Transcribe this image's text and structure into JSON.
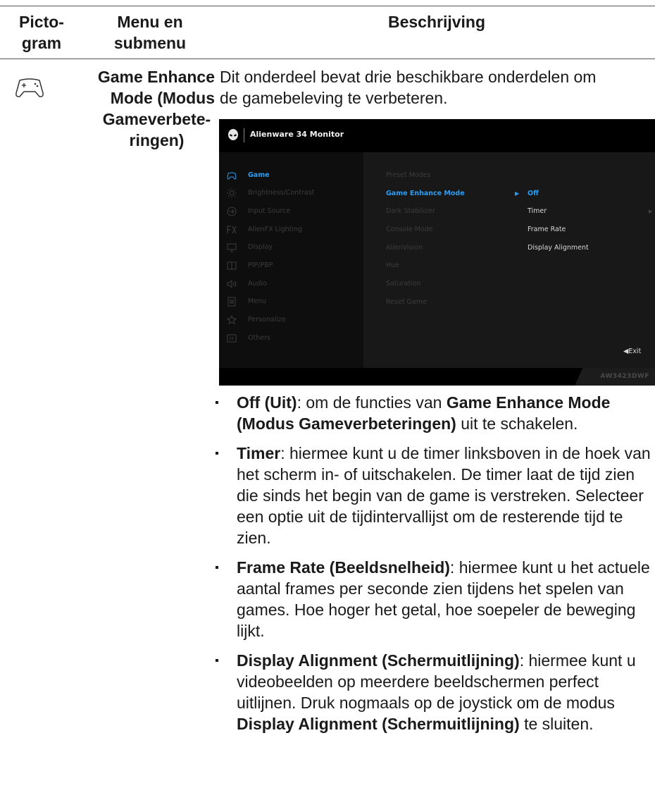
{
  "header": {
    "col1": "Picto-\ngram",
    "col2": "Menu en\nsubmenu",
    "col3": "Beschrijving"
  },
  "row": {
    "icon": "gamepad-icon",
    "menu_line1": "Game Enhance",
    "menu_line2": "Mode (Modus",
    "menu_line3": "Gameverbete-",
    "menu_line4": "ringen)",
    "intro_line1": "Dit onderdeel bevat drie beschikbare onderdelen om",
    "intro_line2": "de gamebeleving te verbeteren."
  },
  "osd": {
    "title": "Alienware 34 Monitor",
    "accent": "#2a9df4",
    "menu": [
      {
        "label": "Game",
        "icon": "gamepad-icon"
      },
      {
        "label": "Brightness/Contrast",
        "icon": "brightness-icon"
      },
      {
        "label": "Input Source",
        "icon": "input-source-icon"
      },
      {
        "label": "AlienFX Lighting",
        "icon": "fx-icon"
      },
      {
        "label": "Display",
        "icon": "display-icon"
      },
      {
        "label": "PIP/PBP",
        "icon": "pip-icon"
      },
      {
        "label": "Audio",
        "icon": "audio-icon"
      },
      {
        "label": "Menu",
        "icon": "menu-icon"
      },
      {
        "label": "Personalize",
        "icon": "star-icon"
      },
      {
        "label": "Others",
        "icon": "others-icon"
      }
    ],
    "submenu": [
      "Preset Modes",
      "Game Enhance Mode",
      "Dark Stabilizer",
      "Console Mode",
      "AlienVision",
      "Hue",
      "Saturation",
      "Reset Game"
    ],
    "options": [
      "Off",
      "Timer",
      "Frame Rate",
      "Display Alignment"
    ],
    "exit": "Exit",
    "model": "AW3423DWF"
  },
  "bullets": [
    {
      "bold": "Off (Uit)",
      "text": ": om de functies van ",
      "bold2": "Game Enhance Mode (Modus Gameverbeteringen)",
      "text2": " uit te schakelen."
    },
    {
      "bold": "Timer",
      "text": ": hiermee kunt u de timer linksboven in de hoek van het scherm in- of uitschakelen. De timer laat de tijd zien die sinds het begin van de game is verstreken. Selecteer een optie uit de tijdintervallijst om de resterende tijd te zien.",
      "bold2": "",
      "text2": ""
    },
    {
      "bold": "Frame Rate (Beeldsnelheid)",
      "text": ": hiermee kunt u het actuele aantal frames per seconde zien tijdens het spelen van games. Hoe hoger het getal, hoe soepeler de beweging lijkt.",
      "bold2": "",
      "text2": ""
    },
    {
      "bold": "Display Alignment (Schermuitlijning)",
      "text": ": hiermee kunt u videobeelden op meerdere beeldschermen perfect uitlijnen. Druk nogmaals op de joystick om de modus ",
      "bold2": "Display Alignment (Schermuitlijning)",
      "text2": " te sluiten."
    }
  ]
}
